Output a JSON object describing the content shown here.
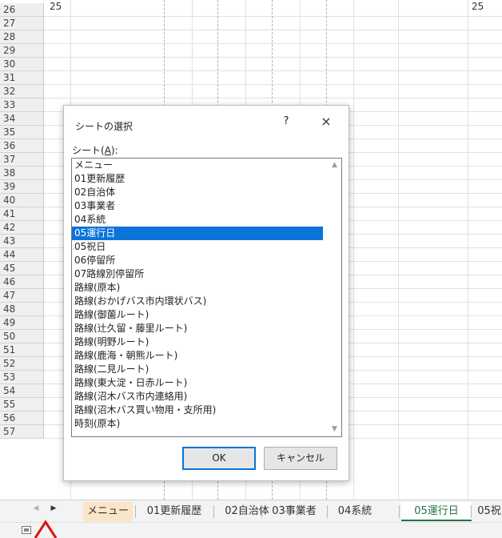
{
  "sheet": {
    "row_numbers": [
      "26",
      "27",
      "28",
      "29",
      "30",
      "31",
      "32",
      "33",
      "34",
      "35",
      "36",
      "37",
      "38",
      "39",
      "40",
      "41",
      "42",
      "43",
      "44",
      "45",
      "46",
      "47",
      "48",
      "49",
      "50",
      "51",
      "52",
      "53",
      "54",
      "55",
      "56",
      "57"
    ],
    "cell_a26": "25",
    "cell_right26": "25"
  },
  "dialog": {
    "title": "シートの選択",
    "help": "?",
    "close": "×",
    "list_label_prefix": "シート(",
    "list_label_key": "A",
    "list_label_suffix": "):",
    "items": [
      "メニュー",
      "01更新履歴",
      "02自治体",
      "03事業者",
      "04系統",
      "05運行日",
      "05祝日",
      "06停留所",
      "07路線別停留所",
      "路線(原本)",
      "路線(おかげバス市内環状バス)",
      "路線(御薗ルート)",
      "路線(辻久留・藤里ルート)",
      "路線(明野ルート)",
      "路線(鹿海・朝熊ルート)",
      "路線(二見ルート)",
      "路線(東大淀・日赤ルート)",
      "路線(沼木バス市内連絡用)",
      "路線(沼木バス買い物用・支所用)",
      "時刻(原本)"
    ],
    "selected_item": "05運行日",
    "scroll_up": "▲",
    "scroll_down": "▼",
    "ok_label": "OK",
    "cancel_label": "キャンセル"
  },
  "tabbar": {
    "nav_prev": "◀",
    "nav_next": "▶",
    "tabs": [
      "メニュー",
      "01更新履歴",
      "02自治体",
      "03事業者",
      "04系統",
      "05運行日",
      "05祝"
    ],
    "active_tab": "05運行日"
  },
  "colors": {
    "selection": "#0a74da",
    "active_tab_text": "#217346",
    "menu_tab_bg": "#fbe5c8",
    "annotation_red": "#e01010"
  }
}
